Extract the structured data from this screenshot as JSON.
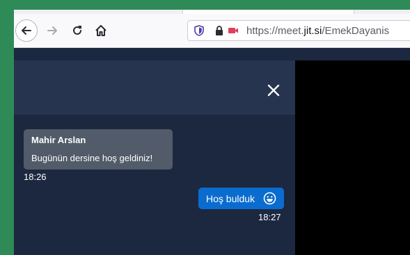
{
  "browser": {
    "url_prefix": "https://meet.",
    "url_domain": "jit.si",
    "url_path": "/EmekDayanis"
  },
  "toolbar_icons": [
    "back-arrow-icon",
    "forward-arrow-icon",
    "reload-icon",
    "home-icon"
  ],
  "urlbar_icons": [
    "shield-icon",
    "lock-icon",
    "camera-blocked-icon"
  ],
  "chat": {
    "close_icon": "close-icon",
    "messages": [
      {
        "direction": "incoming",
        "sender": "Mahir Arslan",
        "text": "Bugünün dersine hoş geldiniz!",
        "time": "18:26"
      },
      {
        "direction": "outgoing",
        "text": "Hoş bulduk",
        "emoji": "smile-icon",
        "time": "18:27"
      }
    ]
  },
  "colors": {
    "page_background": "#2e8b57",
    "chat_background": "#1c2840",
    "chat_header": "#263450",
    "incoming_bubble": "#525b69",
    "outgoing_bubble": "#0b6ccf",
    "video_background": "#000000"
  }
}
